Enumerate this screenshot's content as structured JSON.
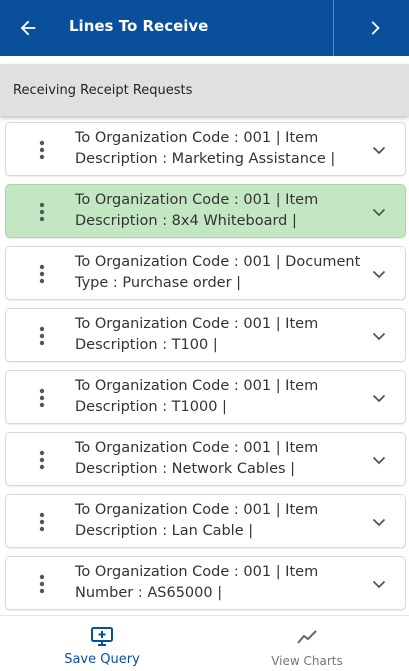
{
  "header": {
    "title": "Lines To Receive"
  },
  "subheader": {
    "title": "Receiving Receipt Requests"
  },
  "rows": [
    {
      "line1": "To Organization Code : 001 | Item",
      "line2": "Description : Marketing Assistance |",
      "selected": false
    },
    {
      "line1": "To Organization Code : 001 | Item",
      "line2": "Description : 8x4 Whiteboard |",
      "selected": true
    },
    {
      "line1": "To Organization Code : 001 | Document",
      "line2": "Type : Purchase order |",
      "selected": false
    },
    {
      "line1": "To Organization Code : 001 | Item",
      "line2": "Description : T100 |",
      "selected": false
    },
    {
      "line1": "To Organization Code : 001 | Item",
      "line2": "Description : T1000 |",
      "selected": false
    },
    {
      "line1": "To Organization Code : 001 | Item",
      "line2": "Description : Network Cables |",
      "selected": false
    },
    {
      "line1": "To Organization Code : 001 | Item",
      "line2": "Description : Lan Cable |",
      "selected": false
    },
    {
      "line1": "To Organization Code : 001 | Item",
      "line2": "Number : AS65000 |",
      "selected": false
    }
  ],
  "footer": {
    "save_query": "Save Query",
    "view_charts": "View Charts"
  },
  "colors": {
    "header_bg": "#0a4f9c",
    "selected_row": "#c3e7c3",
    "active_tab": "#0a4f9c"
  }
}
